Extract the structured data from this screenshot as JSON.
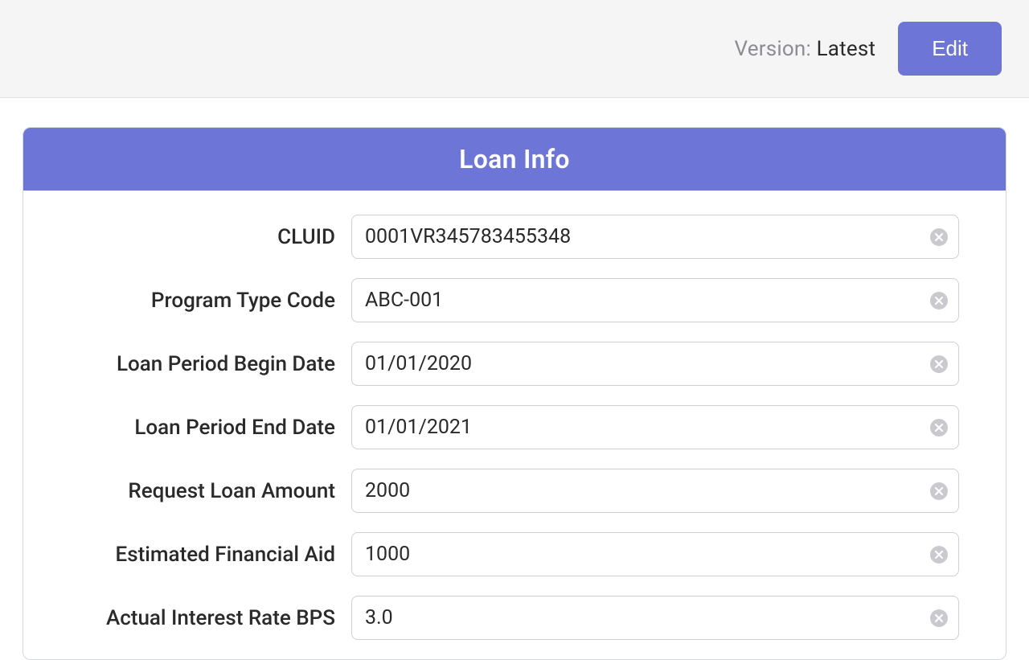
{
  "colors": {
    "accent": "#6d76d6",
    "topbar_bg": "#f5f5f5",
    "border": "#cfcfd6",
    "clear_icon": "#c9c9cf"
  },
  "topbar": {
    "version_label": "Version:",
    "version_value": "Latest",
    "edit_label": "Edit"
  },
  "card": {
    "title": "Loan Info"
  },
  "fields": {
    "cluid": {
      "label": "CLUID",
      "value": "0001VR345783455348"
    },
    "program_type_code": {
      "label": "Program Type Code",
      "value": "ABC-001"
    },
    "loan_period_begin": {
      "label": "Loan Period Begin Date",
      "value": "01/01/2020"
    },
    "loan_period_end": {
      "label": "Loan Period End Date",
      "value": "01/01/2021"
    },
    "request_loan_amount": {
      "label": "Request Loan Amount",
      "value": "2000"
    },
    "estimated_financial_aid": {
      "label": "Estimated Financial Aid",
      "value": "1000"
    },
    "actual_interest_rate_bps": {
      "label": "Actual Interest Rate BPS",
      "value": "3.0"
    }
  }
}
